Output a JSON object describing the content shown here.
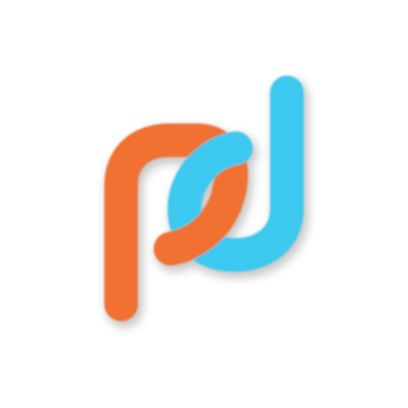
{
  "logo": {
    "icon": "pd-logo-icon",
    "colors": {
      "orange": "#f07131",
      "blue": "#3cc8ef",
      "shadow": "#000000",
      "background": "#ffffff"
    }
  }
}
